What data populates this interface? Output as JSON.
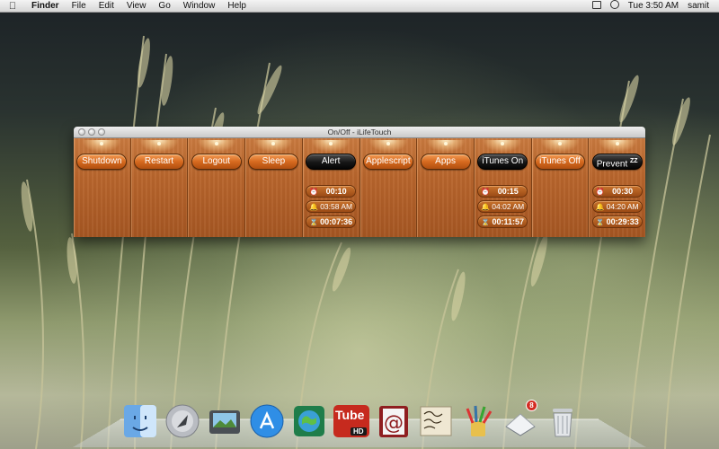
{
  "menubar": {
    "apple": "",
    "app_name": "Finder",
    "menus": [
      "File",
      "Edit",
      "View",
      "Go",
      "Window",
      "Help"
    ],
    "clock": "Tue 3:50 AM",
    "user": "samit"
  },
  "window": {
    "title": "On/Off - iLifeTouch",
    "columns": [
      {
        "label": "Shutdown",
        "style": "orange"
      },
      {
        "label": "Restart",
        "style": "orange"
      },
      {
        "label": "Logout",
        "style": "orange"
      },
      {
        "label": "Sleep",
        "style": "orange"
      },
      {
        "label": "Alert",
        "style": "dark",
        "timer": "00:10",
        "time": "03:58 AM",
        "countdown": "00:07:36"
      },
      {
        "label": "Applescript",
        "style": "orange"
      },
      {
        "label": "Apps",
        "style": "orange"
      },
      {
        "label": "iTunes On",
        "style": "dark",
        "timer": "00:15",
        "time": "04:02 AM",
        "countdown": "00:11:57"
      },
      {
        "label": "iTunes Off",
        "style": "orange"
      },
      {
        "label": "Prevent",
        "style": "dark",
        "sup": "ZZ",
        "timer": "00:30",
        "time": "04:20 AM",
        "countdown": "00:29:33"
      }
    ]
  },
  "dock": {
    "items": [
      {
        "icon": "finder-icon"
      },
      {
        "icon": "launchpad-icon"
      },
      {
        "icon": "image-capture-icon"
      },
      {
        "icon": "app-store-icon"
      },
      {
        "icon": "world-map-icon"
      },
      {
        "icon": "tube-hd-icon",
        "label": "Tube",
        "sublabel": "HD"
      },
      {
        "icon": "mail-at-icon"
      },
      {
        "icon": "signature-document-icon"
      },
      {
        "icon": "paint-brushes-icon"
      },
      {
        "icon": "notes-icon",
        "badge": "8"
      },
      {
        "icon": "trash-icon"
      }
    ]
  },
  "colors": {
    "wood": "#b8652c",
    "button_orange": "#d66a1f",
    "button_dark": "#161616",
    "badge_red": "#d42b22"
  }
}
